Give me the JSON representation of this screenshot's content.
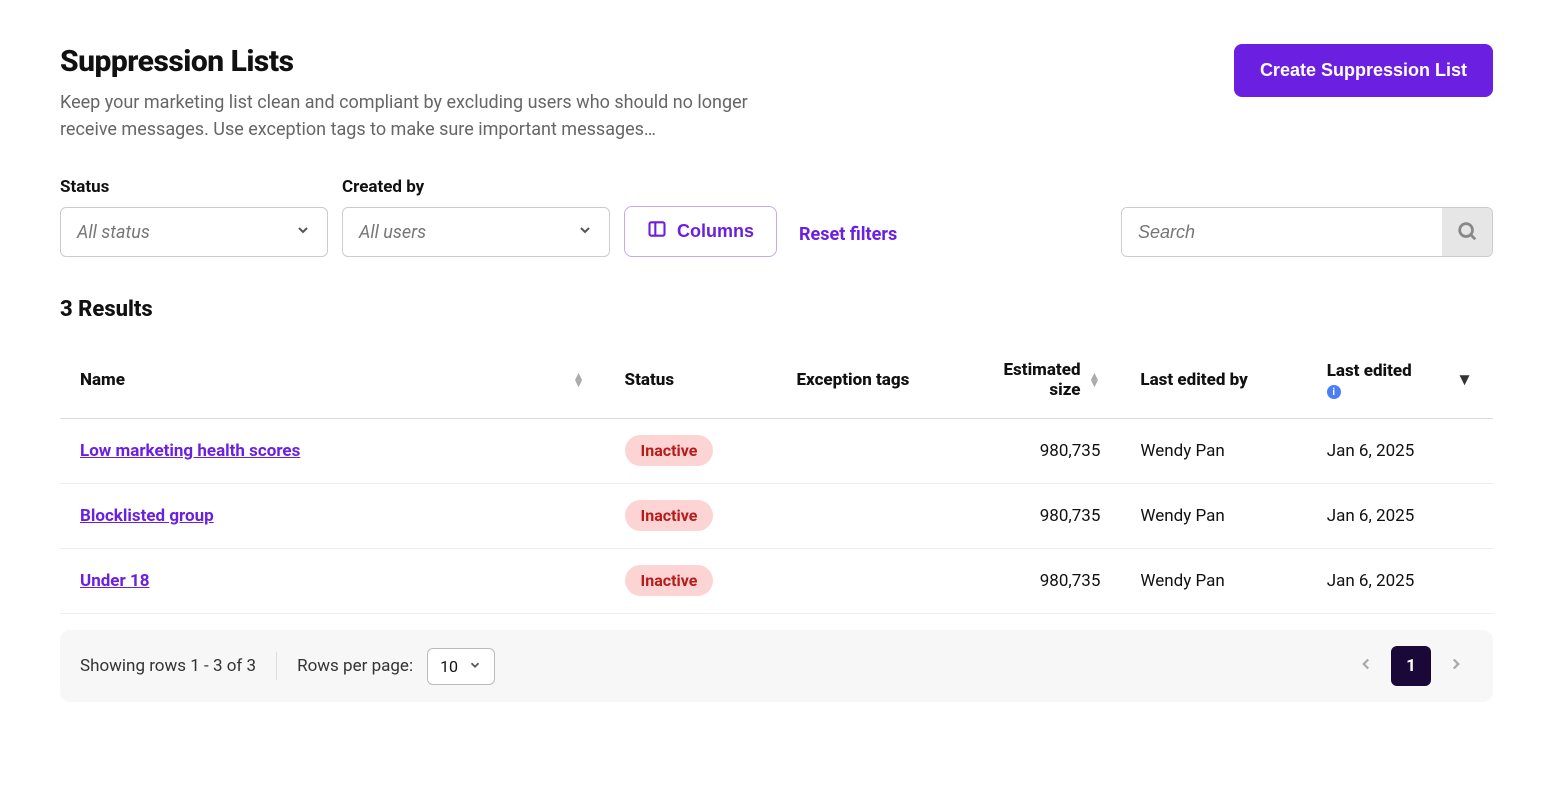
{
  "header": {
    "title": "Suppression Lists",
    "subtitle": "Keep your marketing list clean and compliant by excluding users who should no longer receive messages. Use exception tags to make sure important messages…",
    "create_button": "Create Suppression List"
  },
  "filters": {
    "status": {
      "label": "Status",
      "value": "All status"
    },
    "created_by": {
      "label": "Created by",
      "value": "All users"
    },
    "columns_button": "Columns",
    "reset_filters": "Reset filters",
    "search_placeholder": "Search"
  },
  "results": {
    "count_label": "3 Results"
  },
  "table": {
    "headers": {
      "name": "Name",
      "status": "Status",
      "exception_tags": "Exception tags",
      "estimated_size": "Estimated size",
      "last_edited_by": "Last edited by",
      "last_edited": "Last edited"
    },
    "rows": [
      {
        "name": "Low marketing health scores",
        "status": "Inactive",
        "exception_tags": "",
        "estimated_size": "980,735",
        "last_edited_by": "Wendy Pan",
        "last_edited": "Jan 6, 2025"
      },
      {
        "name": "Blocklisted group",
        "status": "Inactive",
        "exception_tags": "",
        "estimated_size": "980,735",
        "last_edited_by": "Wendy Pan",
        "last_edited": "Jan 6, 2025"
      },
      {
        "name": "Under 18",
        "status": "Inactive",
        "exception_tags": "",
        "estimated_size": "980,735",
        "last_edited_by": "Wendy Pan",
        "last_edited": "Jan 6, 2025"
      }
    ]
  },
  "pagination": {
    "showing": "Showing rows 1 - 3 of 3",
    "rows_per_page_label": "Rows per page:",
    "rows_per_page_value": "10",
    "current_page": "1"
  }
}
